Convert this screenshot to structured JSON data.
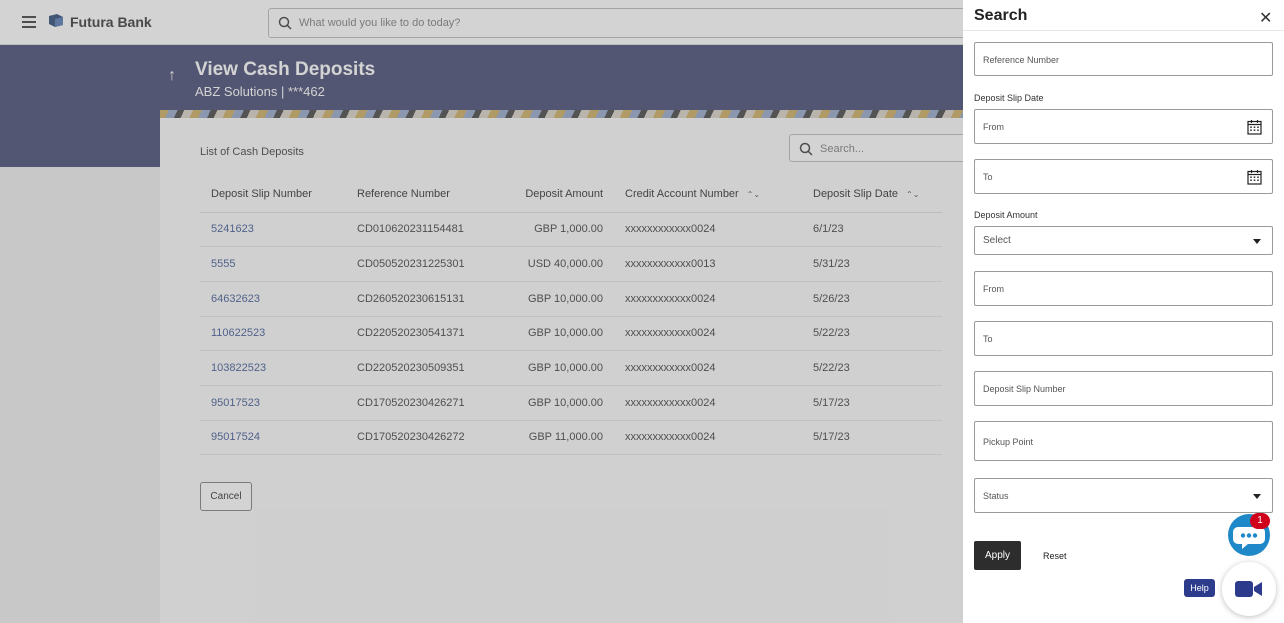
{
  "app": {
    "brand": "Futura Bank",
    "search_placeholder": "What would you like to do today?"
  },
  "header": {
    "title": "View Cash Deposits",
    "subtitle": "ABZ Solutions | ***462"
  },
  "main": {
    "list_title": "List of Cash Deposits",
    "search_placeholder": "Search...",
    "columns": [
      "Deposit Slip Number",
      "Reference Number",
      "Deposit Amount",
      "Credit Account Number",
      "Deposit Slip Date"
    ],
    "rows": [
      [
        "5241623",
        "CD010620231154481",
        "GBP 1,000.00",
        "xxxxxxxxxxxx0024",
        "6/1/23"
      ],
      [
        "5555",
        "CD050520231225301",
        "USD 40,000.00",
        "xxxxxxxxxxxx0013",
        "5/31/23"
      ],
      [
        "64632623",
        "CD260520230615131",
        "GBP 10,000.00",
        "xxxxxxxxxxxx0024",
        "5/26/23"
      ],
      [
        "110622523",
        "CD220520230541371",
        "GBP 10,000.00",
        "xxxxxxxxxxxx0024",
        "5/22/23"
      ],
      [
        "103822523",
        "CD220520230509351",
        "GBP 10,000.00",
        "xxxxxxxxxxxx0024",
        "5/22/23"
      ],
      [
        "95017523",
        "CD170520230426271",
        "GBP 10,000.00",
        "xxxxxxxxxxxx0024",
        "5/17/23"
      ],
      [
        "95017524",
        "CD170520230426272",
        "GBP 11,000.00",
        "xxxxxxxxxxxx0024",
        "5/17/23"
      ]
    ],
    "cancel_label": "Cancel"
  },
  "search_panel": {
    "title": "Search",
    "reference_number": "Reference Number",
    "deposit_slip_date_label": "Deposit Slip Date",
    "date_from": "From",
    "date_to": "To",
    "deposit_amount_label": "Deposit Amount",
    "amount_select": "Select",
    "amount_from": "From",
    "amount_to": "To",
    "deposit_slip_number": "Deposit Slip Number",
    "pickup_point": "Pickup Point",
    "status": "Status",
    "apply_label": "Apply",
    "reset_label": "Reset"
  },
  "widgets": {
    "chat_badge": "1",
    "help_label": "Help"
  },
  "colors": {
    "banner": "#3a3f6b",
    "link": "#35508f",
    "chat": "#1e88c9",
    "help": "#2d3b8c"
  }
}
